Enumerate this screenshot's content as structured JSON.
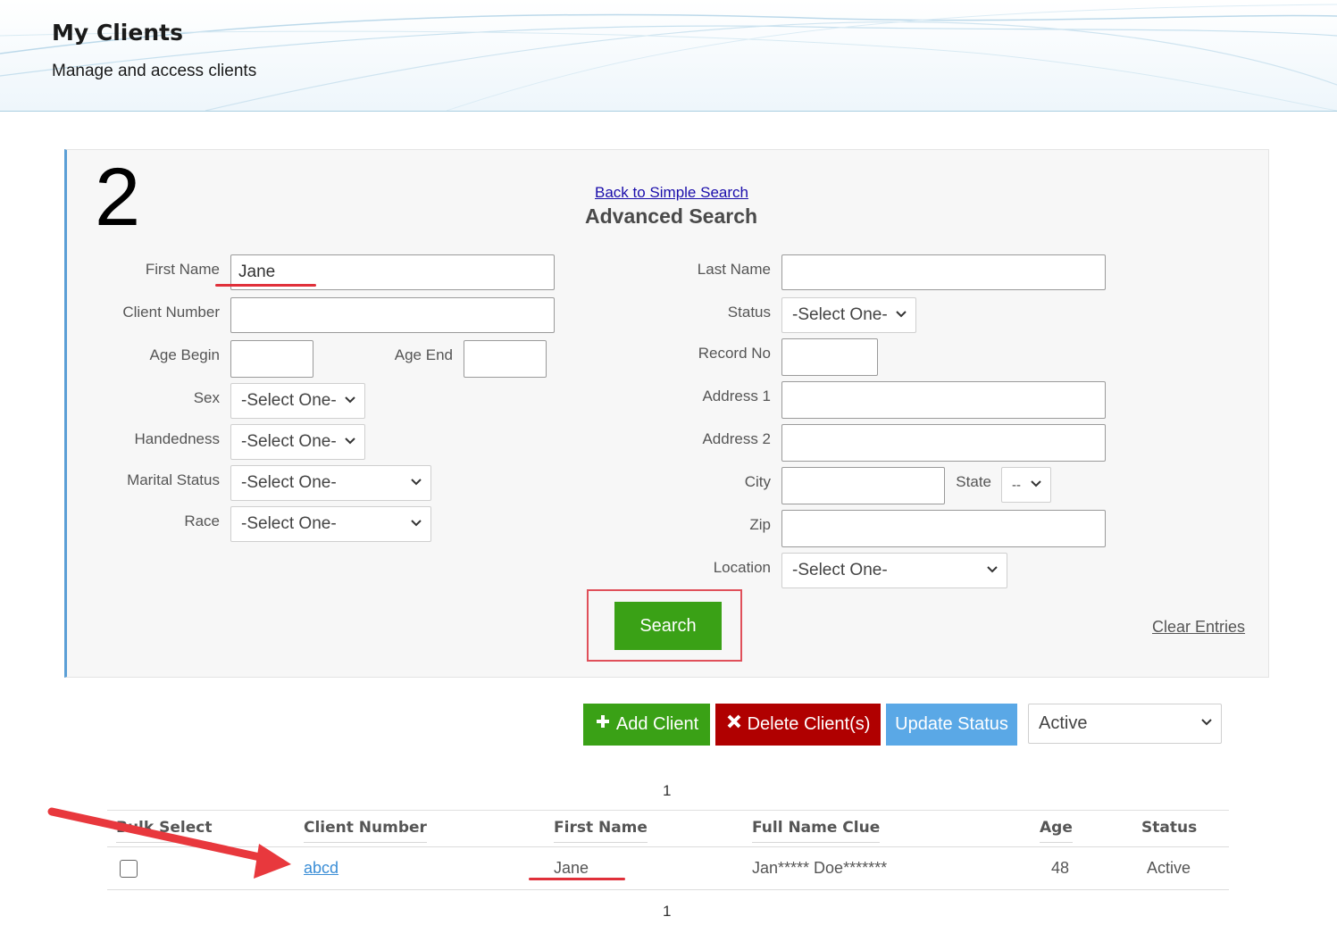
{
  "header": {
    "title": "My Clients",
    "subtitle": "Manage and access clients"
  },
  "search_panel": {
    "step_number": "2",
    "back_link": "Back to Simple Search",
    "title": "Advanced Search",
    "fields": {
      "first_name": {
        "label": "First Name",
        "value": "Jane"
      },
      "client_number": {
        "label": "Client Number",
        "value": ""
      },
      "age_begin": {
        "label": "Age Begin",
        "value": ""
      },
      "age_end": {
        "label": "Age End",
        "value": ""
      },
      "sex": {
        "label": "Sex",
        "value": "-Select One-"
      },
      "handedness": {
        "label": "Handedness",
        "value": "-Select One-"
      },
      "marital_status": {
        "label": "Marital Status",
        "value": "-Select One-"
      },
      "race": {
        "label": "Race",
        "value": "-Select One-"
      },
      "last_name": {
        "label": "Last Name",
        "value": ""
      },
      "status": {
        "label": "Status",
        "value": "-Select One-"
      },
      "record_no": {
        "label": "Record No",
        "value": ""
      },
      "address1": {
        "label": "Address 1",
        "value": ""
      },
      "address2": {
        "label": "Address 2",
        "value": ""
      },
      "city": {
        "label": "City",
        "value": ""
      },
      "state": {
        "label": "State",
        "value": "--"
      },
      "zip": {
        "label": "Zip",
        "value": ""
      },
      "location": {
        "label": "Location",
        "value": "-Select One-"
      }
    },
    "search_button": "Search",
    "clear_link": "Clear Entries"
  },
  "actions": {
    "add_client": "Add Client",
    "delete_clients": "Delete Client(s)",
    "update_status": "Update Status",
    "status_filter": "Active"
  },
  "pagination": {
    "top": "1",
    "bottom": "1"
  },
  "table": {
    "headers": [
      "Bulk Select",
      "Client Number",
      "First Name",
      "Full Name Clue",
      "Age",
      "Status"
    ],
    "rows": [
      {
        "client_number": "abcd",
        "first_name": "Jane",
        "full_name_clue": "Jan***** Doe*******",
        "age": "48",
        "status": "Active"
      }
    ]
  },
  "colors": {
    "accent_green": "#3aa116",
    "danger_red": "#b00000",
    "info_blue": "#5aa8e6",
    "annotation_red": "#e0303a"
  }
}
